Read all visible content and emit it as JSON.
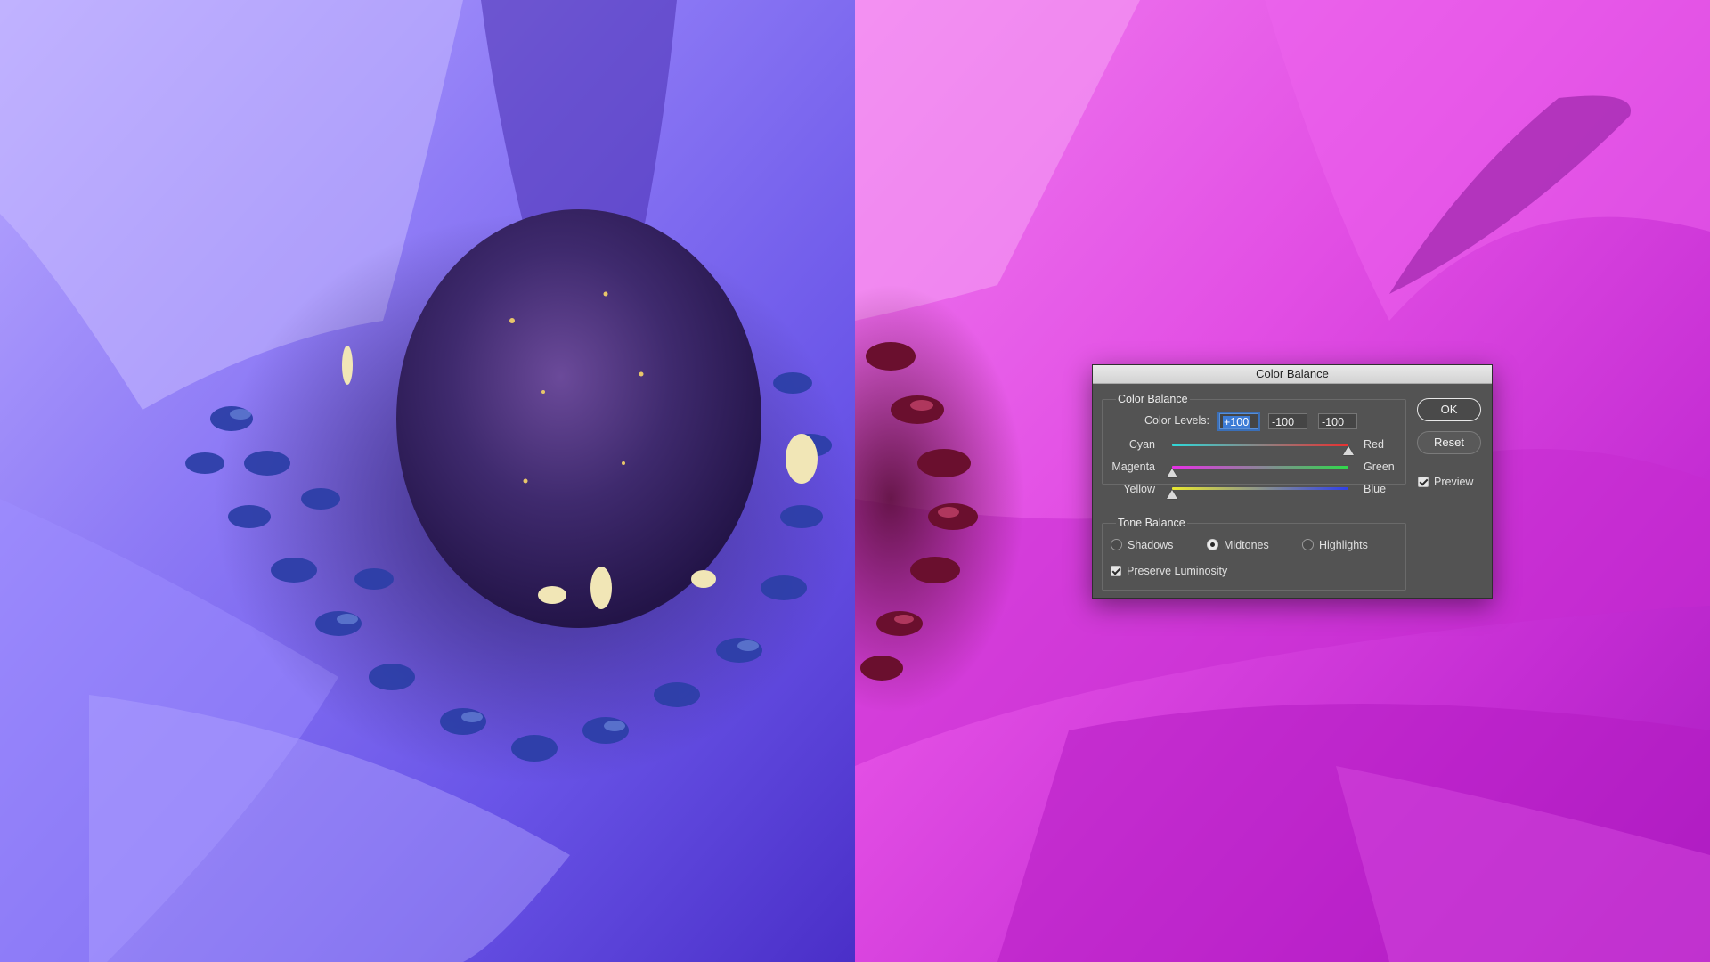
{
  "dialog": {
    "title": "Color Balance",
    "color_balance_group": {
      "title": "Color Balance",
      "color_levels_label": "Color Levels:",
      "levels": [
        "+100",
        "-100",
        "-100"
      ],
      "sliders": [
        {
          "left": "Cyan",
          "right": "Red",
          "value": 100
        },
        {
          "left": "Magenta",
          "right": "Green",
          "value": -100
        },
        {
          "left": "Yellow",
          "right": "Blue",
          "value": -100
        }
      ]
    },
    "tone_balance_group": {
      "title": "Tone Balance",
      "options": [
        "Shadows",
        "Midtones",
        "Highlights"
      ],
      "selected": "Midtones",
      "preserve_luminosity": {
        "label": "Preserve Luminosity",
        "checked": true
      }
    },
    "buttons": {
      "ok": "OK",
      "reset": "Reset"
    },
    "preview": {
      "label": "Preview",
      "checked": true
    }
  },
  "photo": {
    "left_half_tint": "#7a6cf0",
    "right_half_tint": "#e23fe6"
  }
}
